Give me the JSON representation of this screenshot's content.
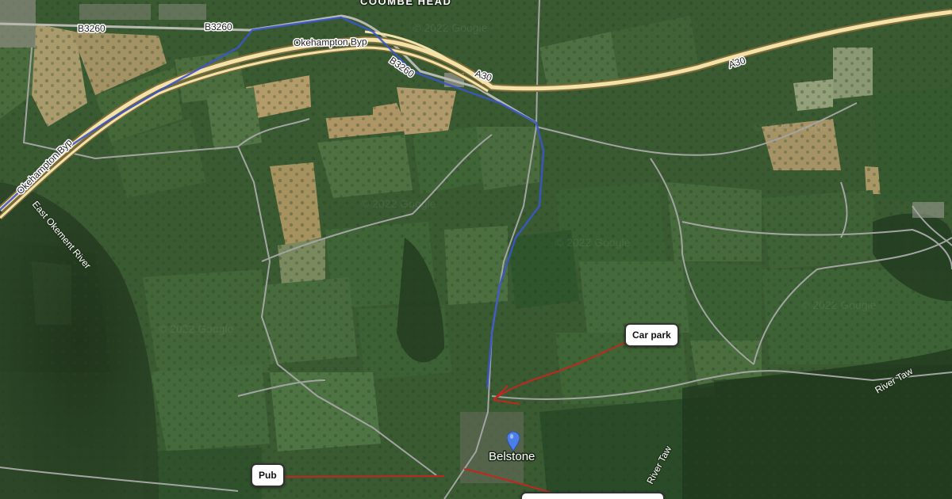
{
  "map": {
    "type": "satellite",
    "colors": {
      "field_dark": "#2f4a2a",
      "field_mid": "#3f5f35",
      "field_light": "#5c7a45",
      "field_tan": "#a8946a",
      "road_lane": "#9c9c9c",
      "a_road": "#f3e3a8",
      "route_blue": "#3a55c8",
      "route_red": "#c0281f",
      "pin_blue": "#4c7ee8"
    },
    "labels": {
      "top_place": "COOMBE HEAD",
      "b3260_west": "B3260",
      "b3260_north": "B3260",
      "b3260_east": "B3260",
      "bypass_north": "Okehampton Byp",
      "bypass_west": "Okehampton Byp",
      "a30_mid": "A30",
      "a30_east": "A30",
      "river_east_okement": "East Okement River",
      "river_taw_south": "River Taw",
      "river_taw_east": "River Taw",
      "village": "Belstone"
    },
    "watermarks": [
      "© 2022 Google",
      "© 2022 Google",
      "© 2022 Google",
      "© 2022 Google",
      "© 2022 Google",
      "© 2022 Google"
    ],
    "markers": {
      "car_park_label": "Car park",
      "pub_label": "Pub",
      "village_pin_icon": "map-pin-icon"
    }
  }
}
